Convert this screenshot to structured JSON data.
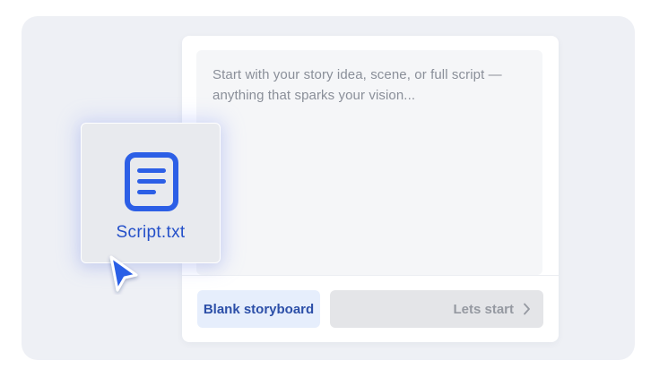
{
  "composer": {
    "placeholder": "Start with your story idea, scene, or full script — anything that sparks your vision...",
    "placeholder_line1": "Start with your story idea, scene, or full script —",
    "placeholder_line2": "anything that sparks your vision...",
    "blank_button_label": "Blank storyboard",
    "start_button_label": "Lets start",
    "start_button_icon": "chevron-right-icon"
  },
  "attachment": {
    "file_name": "Script.txt",
    "icon": "document-icon"
  },
  "cursor": {
    "icon": "pointer-cursor-icon"
  },
  "colors": {
    "accent": "#2c5fe6",
    "blank_button_bg": "#e6eefc",
    "blank_button_text": "#2c4fa8",
    "start_button_bg": "#e4e5e8",
    "start_button_text": "#9599a1",
    "stage_bg": "#eef0f5"
  }
}
